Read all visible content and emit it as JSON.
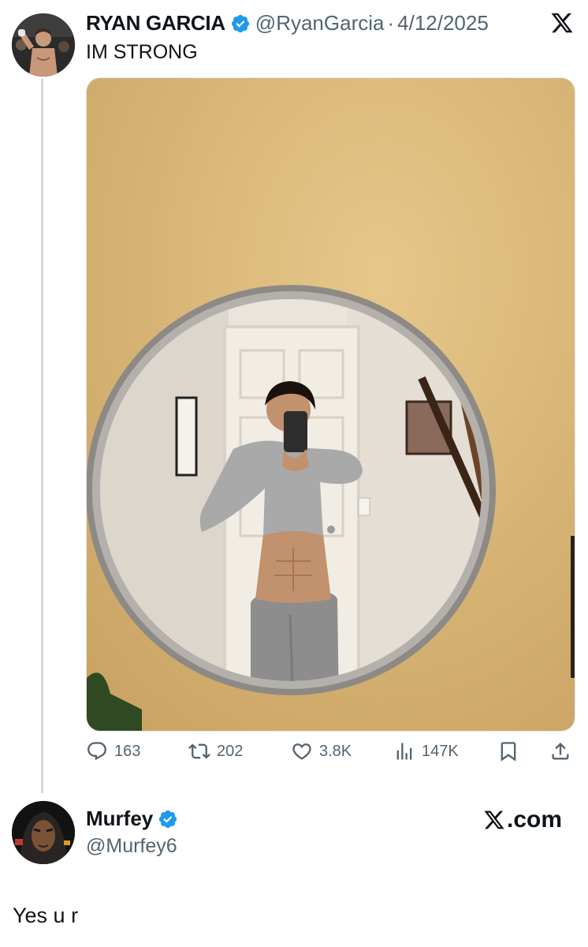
{
  "tweet": {
    "author_name": "RYAN GARCIA",
    "handle": "@RyanGarcia",
    "separator": "·",
    "date": "4/12/2025",
    "text": "IM STRONG",
    "verified": true,
    "avatar_icon": "boxer-avatar",
    "media_description_icon": "mirror-selfie-photo"
  },
  "actions": {
    "replies": "163",
    "retweets": "202",
    "likes": "3.8K",
    "views": "147K"
  },
  "reply": {
    "author_name": "Murfey",
    "handle": "@Murfey6",
    "verified": true,
    "text": "Yes u r",
    "watermark": ".com"
  },
  "colors": {
    "verified": "#1d9bf0",
    "secondary_text": "#536471",
    "thread_line": "#cfd9de",
    "wall": "#d8b56e"
  }
}
